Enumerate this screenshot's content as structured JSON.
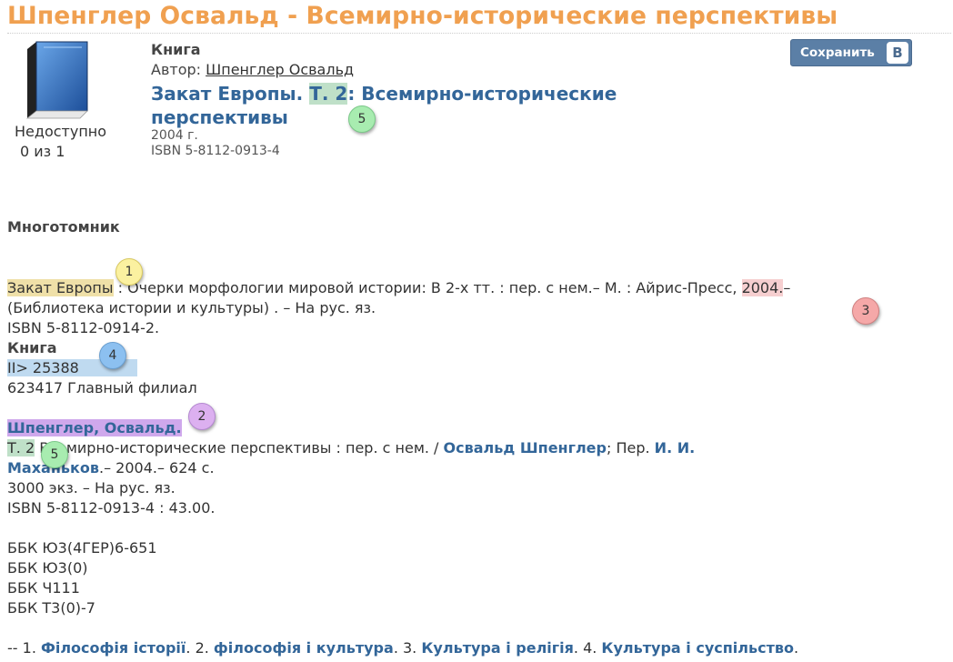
{
  "page_title": "Шпенглер Освальд - Всемирно-исторические перспективы",
  "status": {
    "availability": "Недоступно",
    "count": "0 из 1"
  },
  "record": {
    "type": "Книга",
    "author_label": "Автор:",
    "author_name": "Шпенглер Освальд",
    "title_part1": "Закат Европы.",
    "title_volume": "Т. 2",
    "title_part2": ": Всемирно-исторические перспективы",
    "year": "2004 г.",
    "isbn": "ISBN 5-8112-0913-4"
  },
  "save_button": {
    "label": "Сохранить",
    "vk_letter": "В"
  },
  "multivolume": {
    "heading": "Многотомник",
    "series_title": "Закат Европы",
    "line1_mid": " : Очерки морфологии мировой истории: В 2-х тт. : пер. с нем.– М. : Айрис-Пресс, ",
    "line1_year": "2004.",
    "line1_end": "–",
    "line2": "(Библиотека истории и культуры) . – На рус. яз.",
    "line3": "ISBN 5-8112-0914-2.",
    "book_label": "Книга",
    "inventory": "II> 25388",
    "branch": "623417 Главный филиал"
  },
  "entry": {
    "author_heading": "Шпенглер, Освальд.",
    "volume": "Т. 2",
    "line1_mid": " Всемирно-исторические перспективы : пер. с нем. / ",
    "author_link": "Освальд Шпенглер",
    "line1_sep": "; Пер. ",
    "translator_link_1": "И. И.",
    "translator_link_2": "Маханьков",
    "line2_rest": ".– 2004.– 624 с.",
    "line3": "3000 экз. – На рус. яз.",
    "line4": "ISBN 5-8112-0913-4 : 43.00."
  },
  "bbk": [
    "ББК Ю3(4ГЕР)6-651",
    "ББК Ю3(0)",
    "ББК Ч111",
    "ББК Т3(0)-7"
  ],
  "subjects": {
    "prefix": "-- 1. ",
    "s1": "Філософія історії",
    "sep2": ". 2. ",
    "s2": "філософія і культура",
    "sep3": ". 3. ",
    "s3": "Культура і релігія",
    "sep4": ". 4. ",
    "s4": "Культура і суспільство",
    "end": "."
  },
  "badges": [
    "1",
    "2",
    "3",
    "4",
    "5",
    "5"
  ],
  "colors": {
    "title": "#f0a050",
    "link": "#336699",
    "highlight_yellow": "#efe0a8",
    "highlight_pink": "#f6cfd0",
    "highlight_blue": "#bfdaf0",
    "highlight_purple": "#cfa8ec",
    "highlight_green": "#bfe0c8"
  },
  "icons": {
    "book": "book-icon",
    "vk": "vk-logo-icon"
  }
}
